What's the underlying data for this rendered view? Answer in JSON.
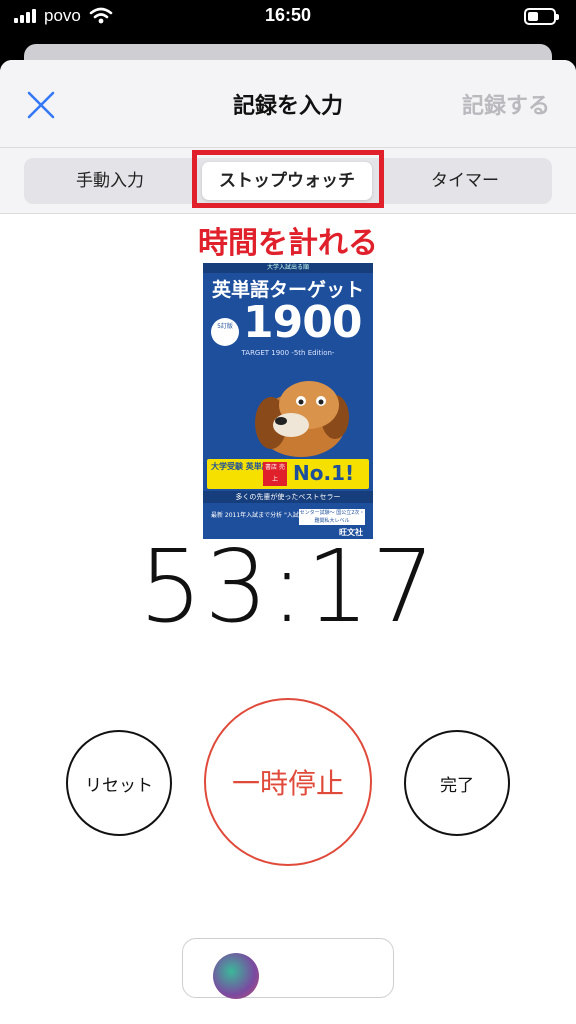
{
  "status_bar": {
    "carrier": "povo",
    "time": "16:50"
  },
  "nav": {
    "title": "記録を入力",
    "save_label": "記録する",
    "close_icon": "close-icon"
  },
  "segments": {
    "items": [
      {
        "label": "手動入力",
        "selected": false
      },
      {
        "label": "ストップウォッチ",
        "selected": true
      },
      {
        "label": "タイマー",
        "selected": false
      }
    ]
  },
  "annotation": "時間を計れる",
  "book": {
    "top_text": "大学入試出る順",
    "title": "英単語ターゲット",
    "number": "1900",
    "badge": "5訂版",
    "subtitle": "TARGET 1900 -5th Edition-",
    "banner_left": "大学受験 英単語集",
    "banner_mid": "書店 売上",
    "banner_right": "No.1!",
    "strip": "多くの先輩が使ったベストセラー",
    "note": "最新 2011年入試まで分析 \"入試に出る順\"",
    "bottom_box": "センター試験～ 国公立2次・難関私大レベル",
    "publisher": "旺文社"
  },
  "timer": {
    "display": "53:17"
  },
  "controls": {
    "reset_label": "リセット",
    "pause_label": "一時停止",
    "done_label": "完了"
  },
  "colors": {
    "accent_blue": "#3478f6",
    "annotation_red": "#e0202a",
    "pause_red": "#e04a3a",
    "disabled_gray": "#b9b9be"
  }
}
